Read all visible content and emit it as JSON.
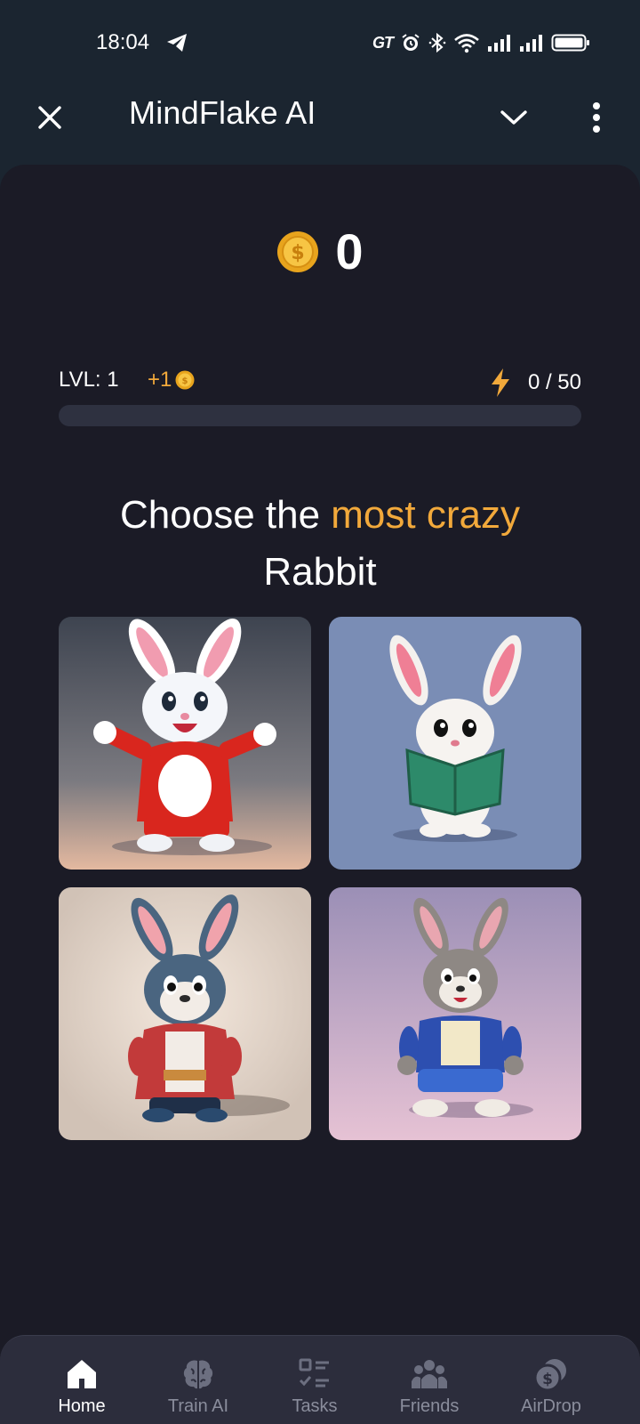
{
  "status_bar": {
    "time": "18:04",
    "icons": [
      "telegram-icon",
      "gt-icon",
      "alarm-icon",
      "bluetooth-icon",
      "wifi-icon",
      "signal-icon",
      "signal-icon",
      "battery-icon"
    ],
    "gt_text": "GT"
  },
  "header": {
    "title": "MindFlake AI",
    "close_icon": "close-icon",
    "expand_icon": "chevron-down-icon",
    "menu_icon": "more-vertical-icon"
  },
  "balance": {
    "value": "0",
    "icon": "coin-icon"
  },
  "level": {
    "label": "LVL: 1",
    "bonus": "+1",
    "energy": "0 / 50",
    "energy_icon": "lightning-icon",
    "progress": 0
  },
  "prompt": {
    "line1_prefix": "Choose the ",
    "line1_highlight": "most crazy",
    "line2": "Rabbit"
  },
  "tiles": [
    {
      "name": "rabbit-red-jacket"
    },
    {
      "name": "rabbit-reading-book"
    },
    {
      "name": "rabbit-red-coat"
    },
    {
      "name": "rabbit-blue-jacket"
    }
  ],
  "nav": {
    "items": [
      {
        "label": "Home",
        "icon": "home-icon",
        "active": true
      },
      {
        "label": "Train AI",
        "icon": "brain-icon",
        "active": false
      },
      {
        "label": "Tasks",
        "icon": "tasks-icon",
        "active": false
      },
      {
        "label": "Friends",
        "icon": "friends-icon",
        "active": false
      },
      {
        "label": "AirDrop",
        "icon": "airdrop-coins-icon",
        "active": false
      }
    ]
  },
  "colors": {
    "accent": "#f2a93b",
    "background": "#1b1b26",
    "header": "#1b2530",
    "nav": "#2c2d3c"
  }
}
